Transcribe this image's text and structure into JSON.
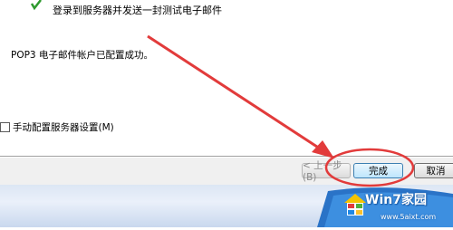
{
  "step": {
    "text": "登录到服务器并发送一封测试电子邮件",
    "icon": "check-icon"
  },
  "result": {
    "text": "POP3 电子邮件帐户已配置成功。"
  },
  "manual_config": {
    "label": "手动配置服务器设置(M)",
    "checked": false
  },
  "buttons": {
    "back_label": "< 上一步(B)",
    "finish_label": "完成",
    "cancel_label": "取消"
  },
  "watermark": {
    "title": "Win7家园",
    "url": "www.5aixt.com"
  },
  "colors": {
    "arrow": "#e23b3b",
    "check": "#2e9a2e",
    "finish_border": "#3c7fb1"
  }
}
